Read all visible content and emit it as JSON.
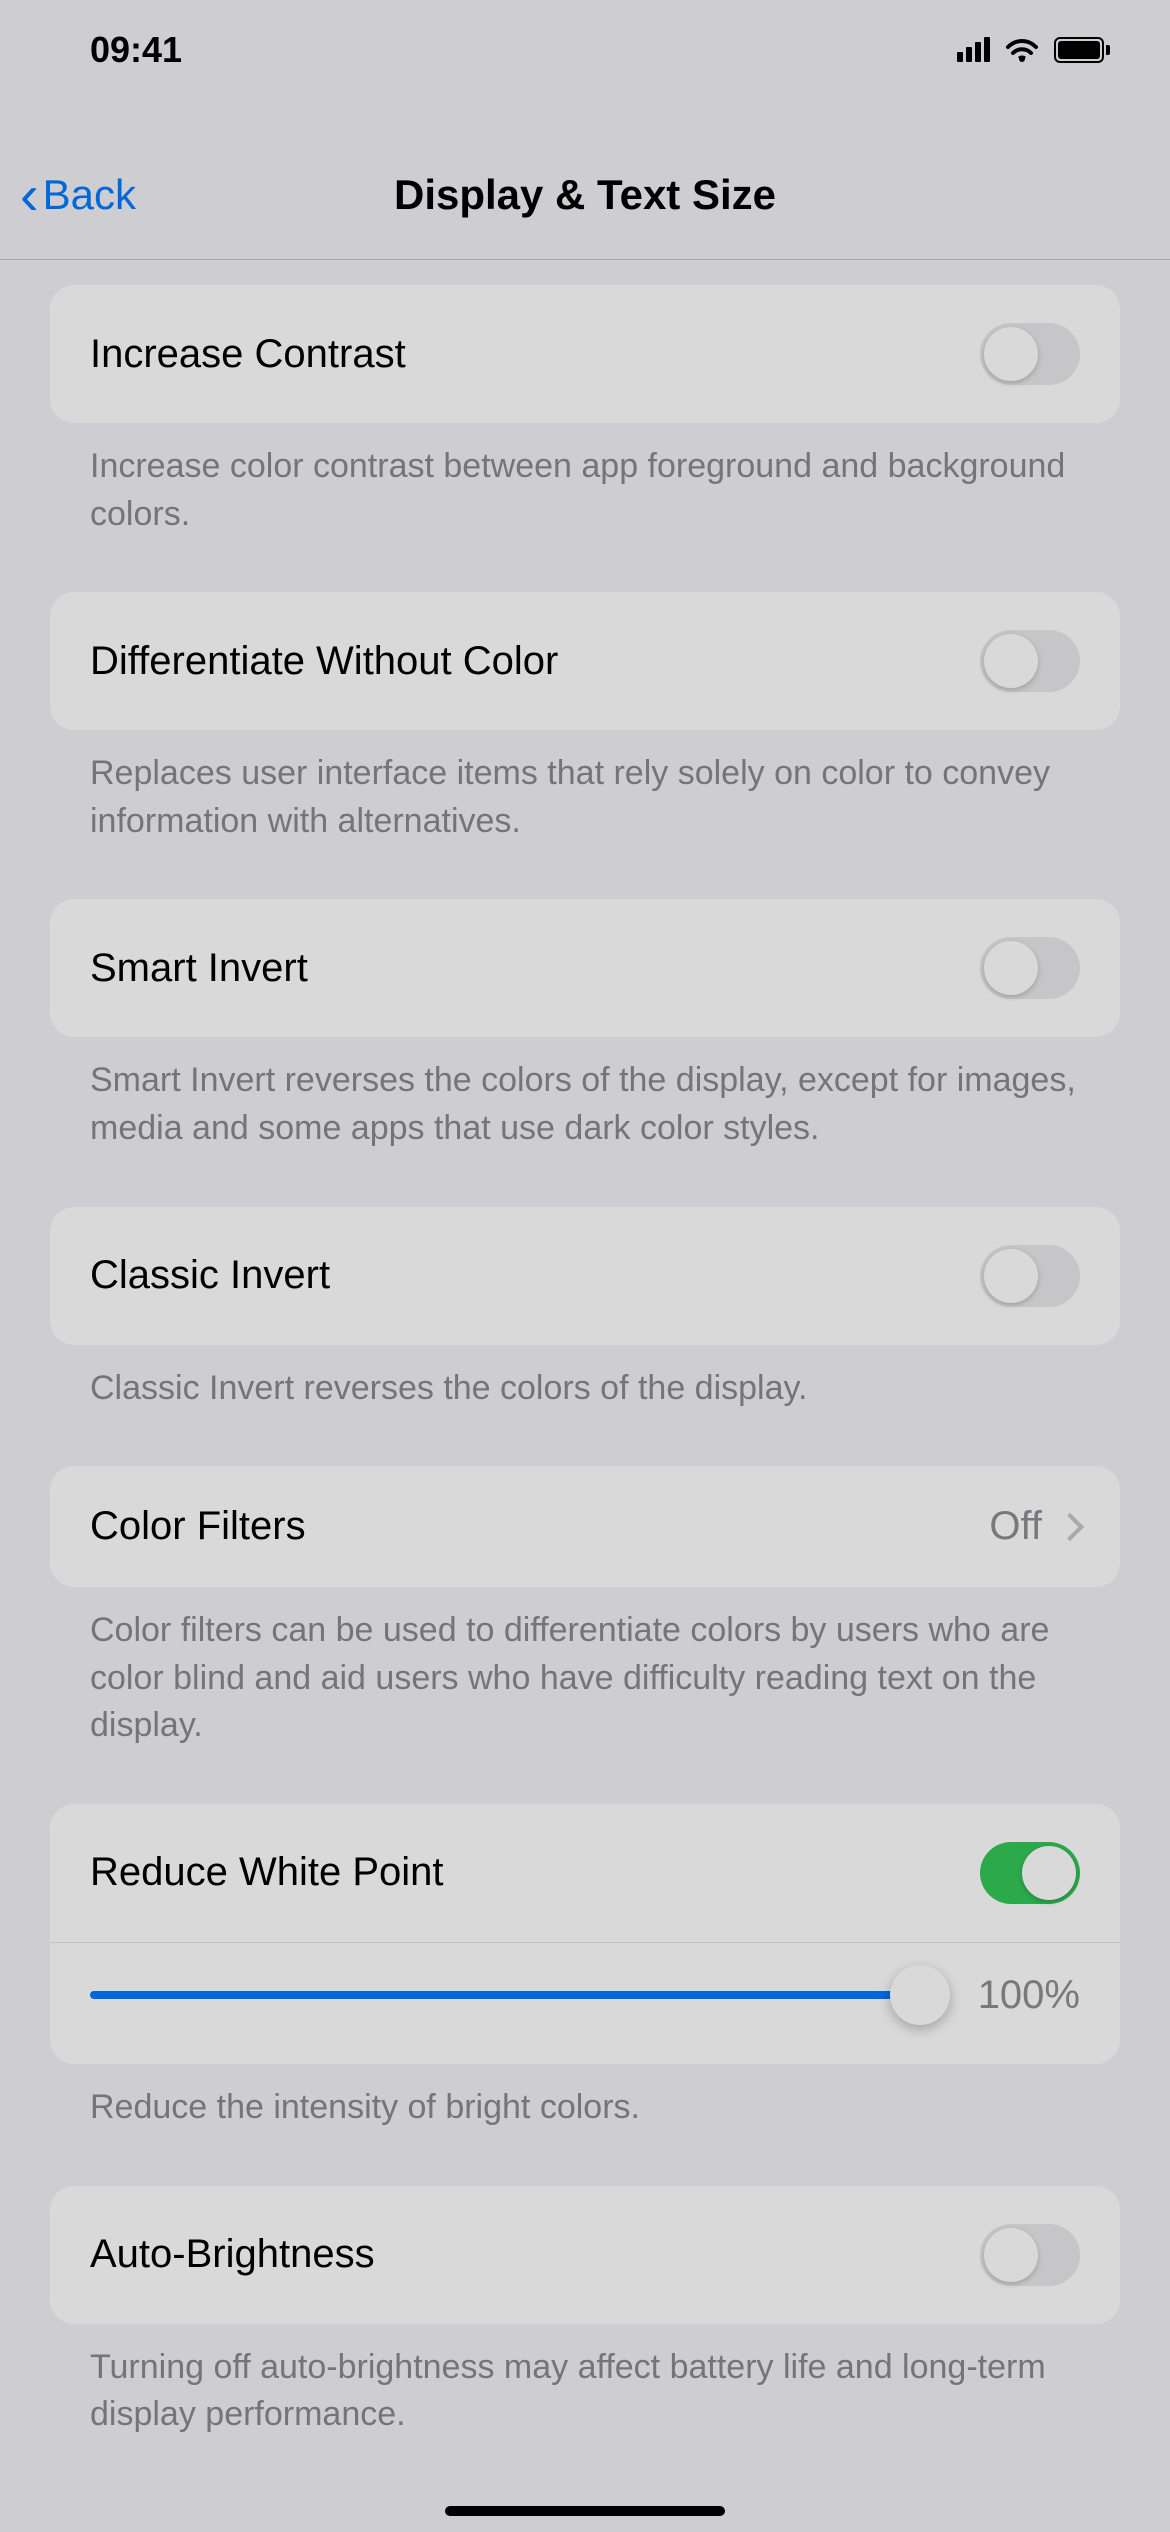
{
  "status": {
    "time": "09:41"
  },
  "nav": {
    "back": "Back",
    "title": "Display & Text Size"
  },
  "rows": {
    "increaseContrast": {
      "label": "Increase Contrast",
      "on": false,
      "footer": "Increase color contrast between app foreground and background colors."
    },
    "differentiate": {
      "label": "Differentiate Without Color",
      "on": false,
      "footer": "Replaces user interface items that rely solely on color to convey information with alternatives."
    },
    "smartInvert": {
      "label": "Smart Invert",
      "on": false,
      "footer": "Smart Invert reverses the colors of the display, except for images, media and some apps that use dark color styles."
    },
    "classicInvert": {
      "label": "Classic Invert",
      "on": false,
      "footer": "Classic Invert reverses the colors of the display."
    },
    "colorFilters": {
      "label": "Color Filters",
      "value": "Off",
      "footer": "Color filters can be used to differentiate colors by users who are color blind and aid users who have difficulty reading text on the display."
    },
    "reduceWhitePoint": {
      "label": "Reduce White Point",
      "on": true,
      "sliderPercent": "100%",
      "footer": "Reduce the intensity of bright colors."
    },
    "autoBrightness": {
      "label": "Auto-Brightness",
      "on": false,
      "footer": "Turning off auto-brightness may affect battery life and long-term display performance."
    }
  }
}
